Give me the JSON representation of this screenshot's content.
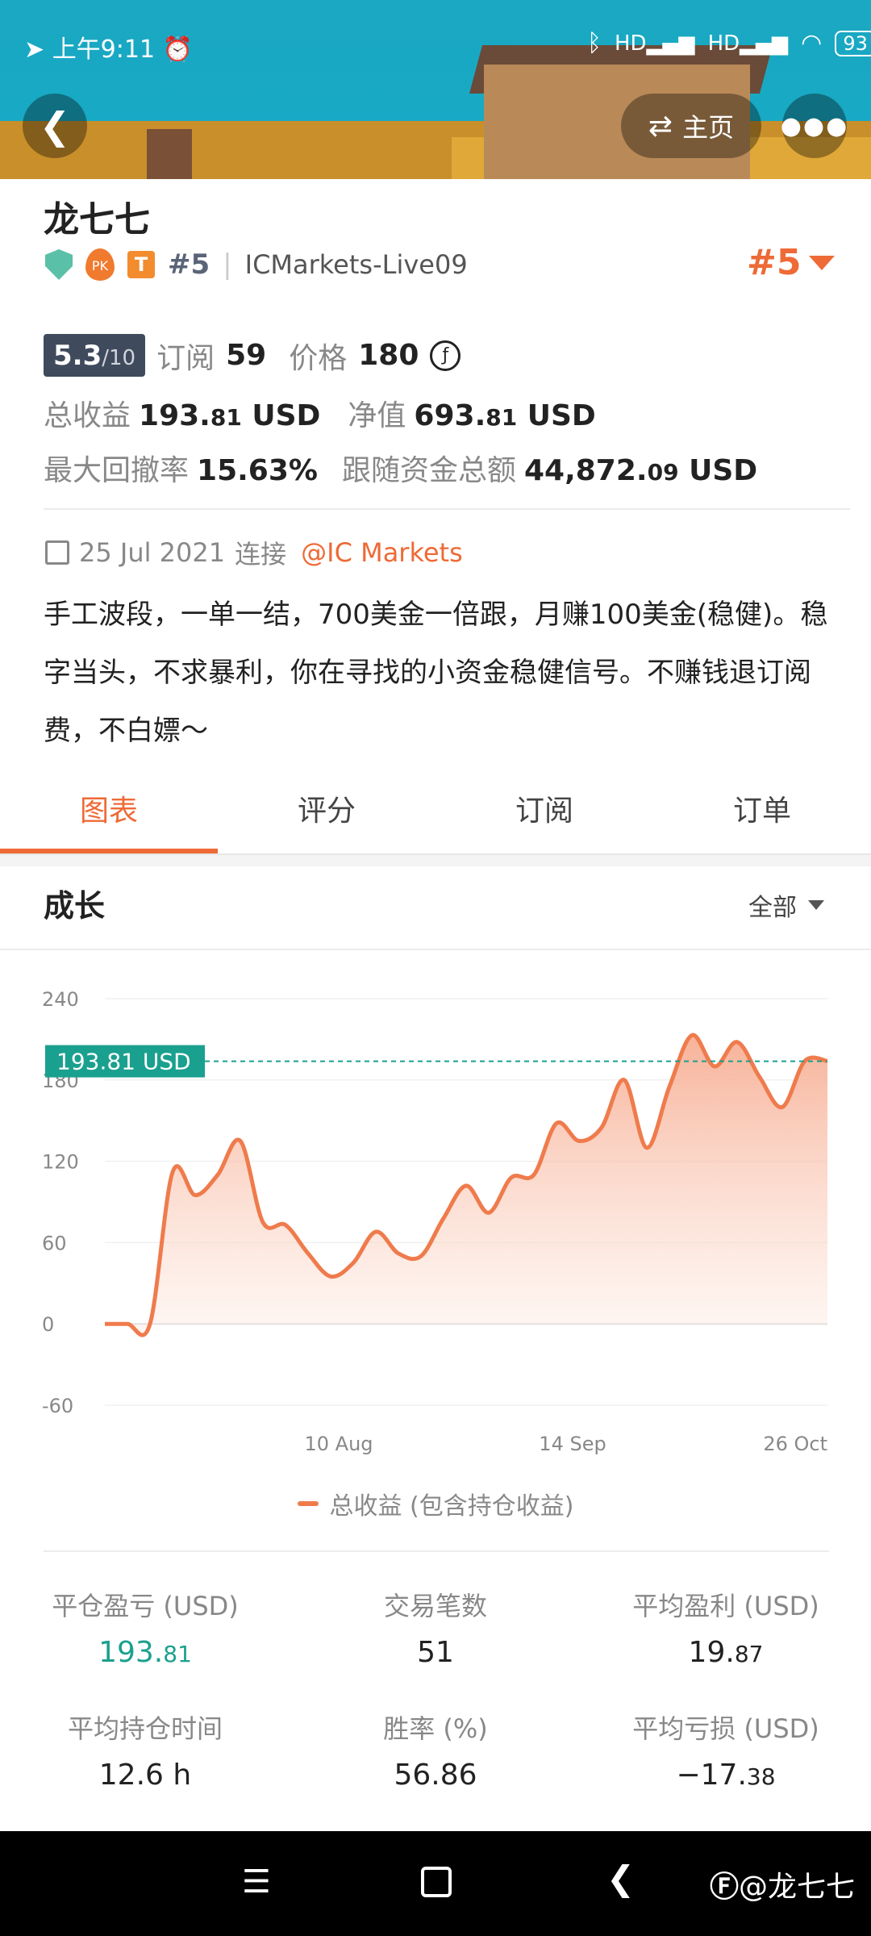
{
  "status_bar": {
    "time": "上午9:11",
    "battery": "93"
  },
  "header": {
    "home_label": "主页"
  },
  "profile": {
    "name": "龙七七",
    "rank": "#5",
    "server": "ICMarkets-Live09",
    "rank_right": "#5",
    "score": "5.3",
    "score_max": "/10",
    "subscribe_label": "订阅",
    "subscribe_count": "59",
    "price_label": "价格",
    "price_value": "180",
    "total_profit_label": "总收益",
    "total_profit_int": "193.",
    "total_profit_dec": "81",
    "total_profit_unit": "USD",
    "equity_label": "净值",
    "equity_int": "693.",
    "equity_dec": "81",
    "equity_unit": "USD",
    "drawdown_label": "最大回撤率",
    "drawdown_value": "15.63%",
    "follow_label": "跟随资金总额",
    "follow_int": "44,872.",
    "follow_dec": "09",
    "follow_unit": "USD",
    "connect_date": "25 Jul 2021",
    "connect_label": "连接",
    "broker": "@IC Markets",
    "description": "手工波段，一单一结，700美金一倍跟，月赚100美金(稳健)。稳字当头，不求暴利，你在寻找的小资金稳健信号。不赚钱退订阅费，不白嫖～"
  },
  "tabs": [
    {
      "label": "图表",
      "active": true
    },
    {
      "label": "评分",
      "active": false
    },
    {
      "label": "订阅",
      "active": false
    },
    {
      "label": "订单",
      "active": false
    }
  ],
  "section": {
    "title": "成长",
    "filter": "全部"
  },
  "chart_data": {
    "type": "area",
    "yticks": [
      "240",
      "180",
      "120",
      "60",
      "0",
      "-60"
    ],
    "ylim": [
      -60,
      240
    ],
    "xticks": [
      "10 Aug",
      "14 Sep",
      "26 Oct"
    ],
    "current_label": "193.81 USD",
    "current_value": 193.81,
    "legend": "总收益 (包含持仓收益)",
    "series": [
      {
        "name": "总收益 (包含持仓收益)",
        "values": [
          0,
          0,
          0,
          112,
          95,
          110,
          135,
          75,
          73,
          52,
          35,
          45,
          68,
          52,
          50,
          78,
          102,
          82,
          108,
          110,
          148,
          135,
          145,
          180,
          130,
          175,
          213,
          190,
          208,
          182,
          160,
          194,
          194
        ]
      }
    ]
  },
  "stats": [
    {
      "label": "平仓盈亏 (USD)",
      "int": "193.",
      "dec": "81",
      "color": "#1aa08e"
    },
    {
      "label": "交易笔数",
      "int": "51",
      "dec": "",
      "color": "#222222"
    },
    {
      "label": "平均盈利 (USD)",
      "int": "19.",
      "dec": "87",
      "color": "#222222"
    },
    {
      "label": "平均持仓时间",
      "int": "12.6 h",
      "dec": "",
      "color": "#222222"
    },
    {
      "label": "胜率 (%)",
      "int": "56.86",
      "dec": "",
      "color": "#222222"
    },
    {
      "label": "平均亏损 (USD)",
      "int": "−17.",
      "dec": "38",
      "color": "#222222"
    }
  ],
  "navbar": {
    "watermark": "@龙七七"
  }
}
